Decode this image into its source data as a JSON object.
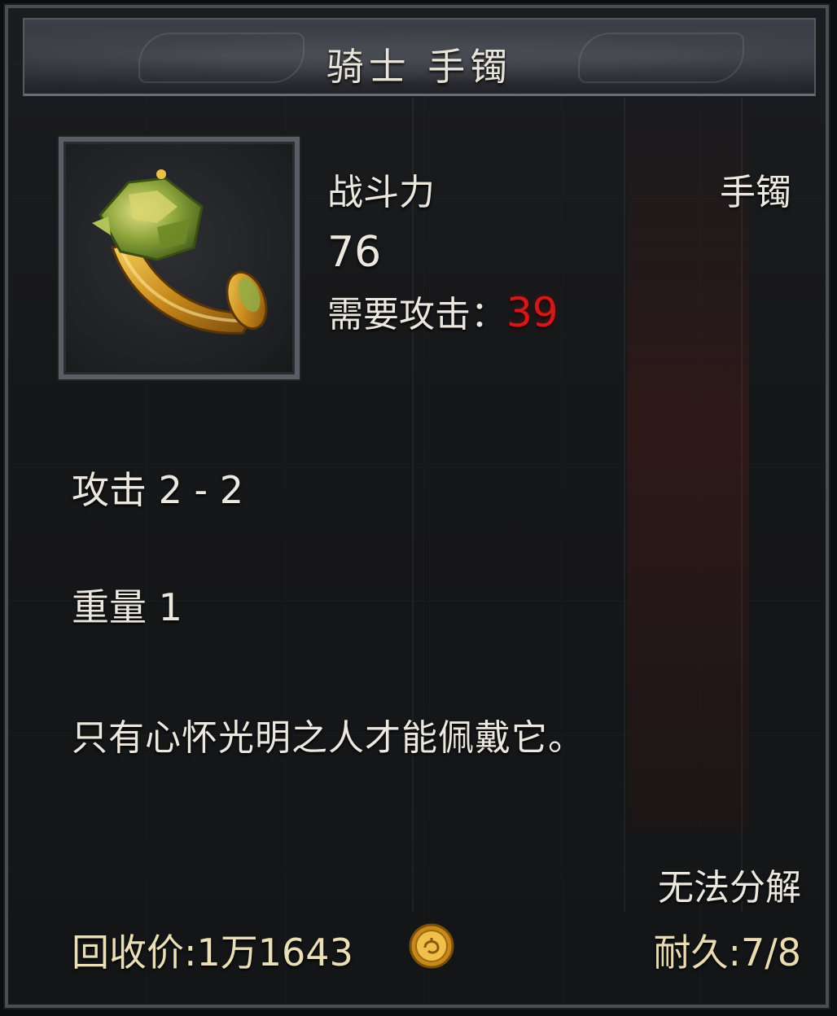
{
  "item": {
    "name": "骑士 手镯",
    "icon": "bracelet-icon",
    "power_label": "战斗力",
    "power_value": "76",
    "type": "手镯",
    "requirement_label": "需要攻击：",
    "requirement_value": "39"
  },
  "stats": {
    "attack": "攻击 2 - 2",
    "weight": "重量 1"
  },
  "description": "只有心怀光明之人才能佩戴它。",
  "footer": {
    "salvage": "无法分解",
    "recycle_price": "回收价:1万1643",
    "currency_icon": "gold-coin-icon",
    "durability": "耐久:7/8"
  },
  "colors": {
    "requirement_unmet": "#d0191b",
    "text": "#ece8df",
    "gold_text": "#eadfb6"
  }
}
